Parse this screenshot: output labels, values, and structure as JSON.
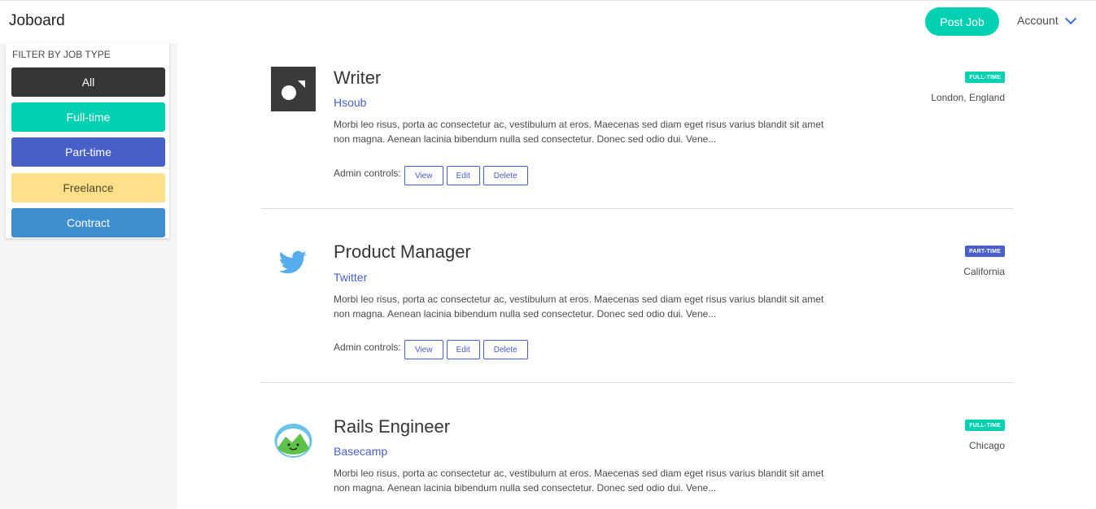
{
  "colors": {
    "accent": "#00d1b2",
    "all": "#363636",
    "full_time": "#00d1b2",
    "part_time": "#485fc7",
    "freelance": "#ffe08a",
    "contract": "#3e8ed0",
    "link": "#485fc7"
  },
  "navbar": {
    "brand": "Joboard",
    "post_job": "Post Job",
    "account": "Account"
  },
  "sidebar": {
    "title": "FILTER BY JOB TYPE",
    "filters": [
      {
        "label": "All"
      },
      {
        "label": "Full-time"
      },
      {
        "label": "Part-time"
      },
      {
        "label": "Freelance"
      },
      {
        "label": "Contract"
      }
    ]
  },
  "jobs": [
    {
      "title": "Writer",
      "company": "Hsoub",
      "description": "Morbi leo risus, porta ac consectetur ac, vestibulum at eros. Maecenas sed diam eget risus varius blandit sit amet non magna. Aenean lacinia bibendum nulla sed consectetur. Donec sed odio dui. Vene...",
      "admin_label": "Admin controls:",
      "view": "View",
      "edit": "Edit",
      "delete": "Delete",
      "tag": "FULL-TIME",
      "location": "London, England",
      "logo": "hsoub-logo-icon"
    },
    {
      "title": "Product Manager",
      "company": "Twitter",
      "description": "Morbi leo risus, porta ac consectetur ac, vestibulum at eros. Maecenas sed diam eget risus varius blandit sit amet non magna. Aenean lacinia bibendum nulla sed consectetur. Donec sed odio dui. Vene...",
      "admin_label": "Admin controls:",
      "view": "View",
      "edit": "Edit",
      "delete": "Delete",
      "tag": "PART-TIME",
      "location": "California",
      "logo": "twitter-bird-icon"
    },
    {
      "title": "Rails Engineer",
      "company": "Basecamp",
      "description": "Morbi leo risus, porta ac consectetur ac, vestibulum at eros. Maecenas sed diam eget risus varius blandit sit amet non magna. Aenean lacinia bibendum nulla sed consectetur. Donec sed odio dui. Vene...",
      "tag": "FULL-TIME",
      "location": "Chicago",
      "logo": "basecamp-logo-icon"
    }
  ]
}
